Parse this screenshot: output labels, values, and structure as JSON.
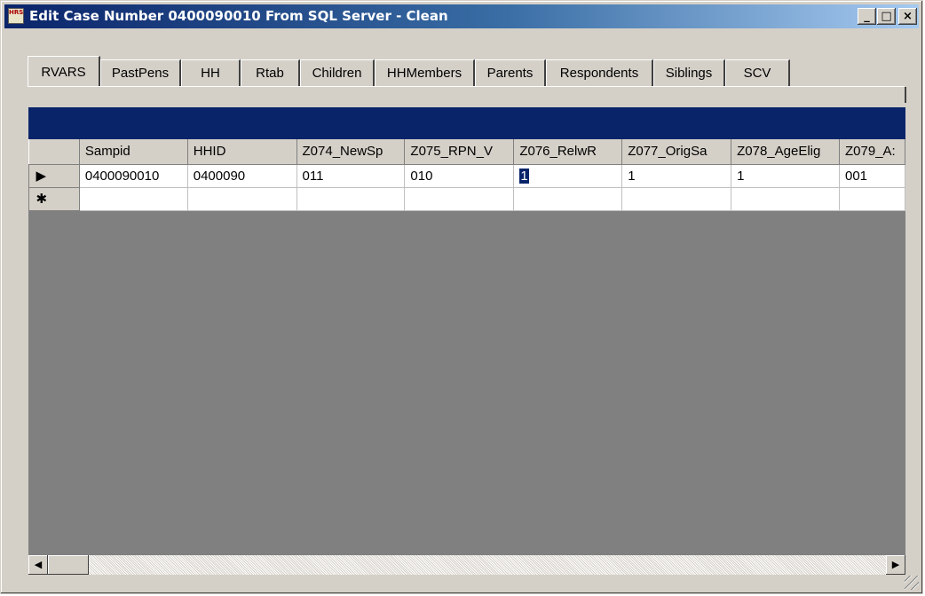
{
  "window": {
    "title": "Edit Case Number 0400090010 From SQL Server - Clean",
    "icon_label": "HRS",
    "controls": {
      "minimize": "_",
      "maximize": "□",
      "close": "×"
    }
  },
  "tabs": [
    {
      "label": "RVARS",
      "active": true
    },
    {
      "label": "PastPens"
    },
    {
      "label": "HH"
    },
    {
      "label": "Rtab"
    },
    {
      "label": "Children"
    },
    {
      "label": "HHMembers"
    },
    {
      "label": "Parents"
    },
    {
      "label": "Respondents"
    },
    {
      "label": "Siblings"
    },
    {
      "label": "SCV"
    }
  ],
  "grid": {
    "columns": [
      "Sampid",
      "HHID",
      "Z074_NewSp",
      "Z075_RPN_V",
      "Z076_RelwR",
      "Z077_OrigSa",
      "Z078_AgeElig",
      "Z079_A:"
    ],
    "rows": [
      {
        "indicator": "▶",
        "cells": [
          "0400090010",
          "0400090",
          "011",
          "010",
          "1",
          "1",
          "1",
          "001"
        ]
      },
      {
        "indicator": "✱",
        "cells": [
          "",
          "",
          "",
          "",
          "",
          "",
          "",
          ""
        ]
      }
    ],
    "selected_cell": {
      "row": 0,
      "col": 4
    }
  },
  "scrollbar": {
    "left_arrow": "◀",
    "right_arrow": "▶"
  }
}
